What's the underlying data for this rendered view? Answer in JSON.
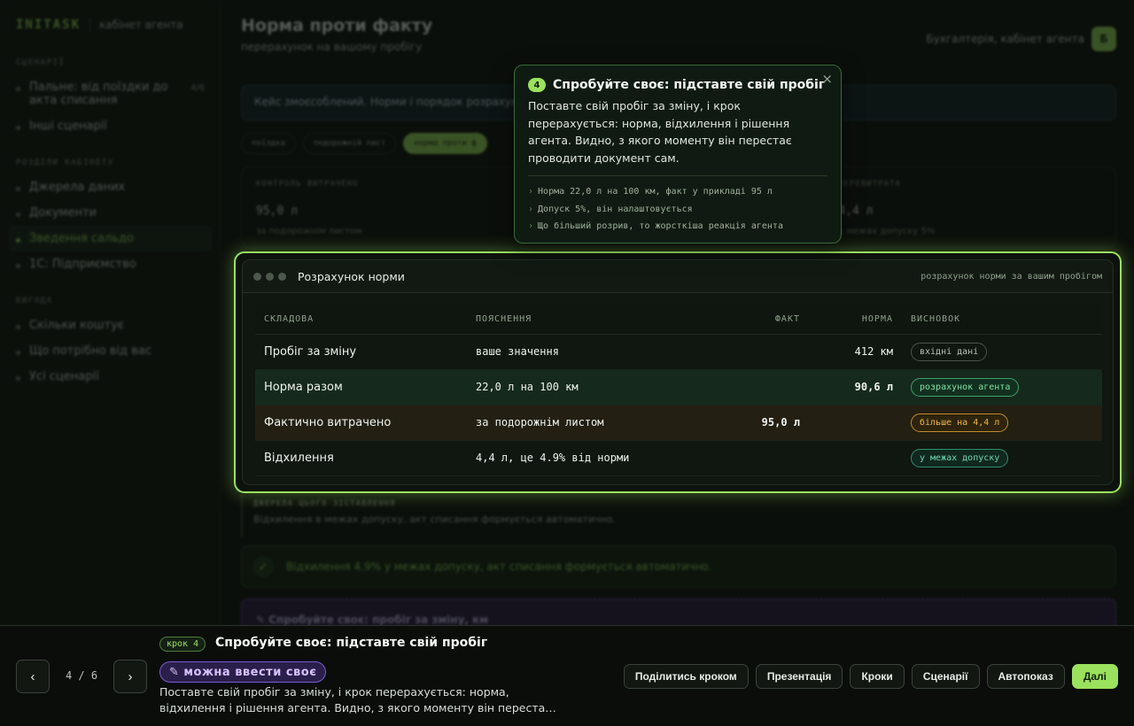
{
  "sidebar": {
    "brand": "INITASK",
    "brand_sub": "кабінет агента",
    "sections": [
      {
        "title": "СЦЕНАРІЇ",
        "items": [
          {
            "label": "Пальне: від поїздки до акта списання",
            "count": "4/6"
          },
          {
            "label": "Інші сценарії"
          }
        ]
      },
      {
        "title": "РОЗДІЛИ КАБІНЕТУ",
        "items": [
          {
            "label": "Джерела даних"
          },
          {
            "label": "Документи"
          },
          {
            "label": "Зведення сальдо"
          },
          {
            "label": "1С: Підприємство"
          }
        ]
      },
      {
        "title": "ВИГОДА",
        "items": [
          {
            "label": "Скільки коштує"
          },
          {
            "label": "Що потрібно від вас"
          },
          {
            "label": "Усі сценарії"
          }
        ]
      }
    ]
  },
  "header": {
    "title": "Норма проти факту",
    "subtitle": "перерахунок на вашому пробігу",
    "account": "Бухгалтерія, кабінет агента",
    "avatar": "Б"
  },
  "info_bar": "Кейс змоєсоблений. Норми і порядок розрахунку",
  "chips": [
    "поїздка",
    "подорожній лист",
    "норма проти ф"
  ],
  "metrics": [
    {
      "key": "КОНТРОЛЬ ВИТРАЧЕНО",
      "value": "95,0 л",
      "sub": "за подорожнім листом"
    },
    {
      "key": "",
      "value": "",
      "sub": ""
    },
    {
      "key": "ПЕРЕВИТРАТА",
      "value": "4,4 л",
      "sub": "у межах допуску 5%"
    }
  ],
  "card": {
    "title": "Розрахунок норми",
    "hint": "розрахунок норми за вашим пробігом",
    "columns": [
      "СКЛАДОВА",
      "ПОЯСНЕННЯ",
      "ФАКТ",
      "НОРМА",
      "ВИСНОВОК"
    ],
    "rows": [
      {
        "item": "Пробіг за зміну",
        "note": "ваше значення",
        "fact": "",
        "norm": "412 км",
        "verdict": "вхідні дані"
      },
      {
        "item": "Норма разом",
        "note": "22,0 л на 100 км",
        "fact": "",
        "norm": "90,6 л",
        "verdict": "розрахунок агента"
      },
      {
        "item": "Фактично витрачено",
        "note": "за подорожнім листом",
        "fact": "95,0 л",
        "norm": "",
        "verdict": "більше на 4,4 л"
      },
      {
        "item": "Відхилення",
        "note": "4,4 л, це 4.9% від норми",
        "fact": "",
        "norm": "",
        "verdict": "у межах допуску"
      }
    ]
  },
  "sources": {
    "title": "ДЖЕРЕЛА ЦЬОГО ЗІСТАВЛЕННЯ",
    "text": "Відхилення в межах допуску, акт списання формується автоматично."
  },
  "result": {
    "check": "✓",
    "text": "Відхилення 4.9% у межах допуску, акт списання формується автоматично."
  },
  "try_box": "✎ Спробуйте своє: пробіг за зміну, км",
  "popover": {
    "num": "4",
    "title": "Спробуйте своє: підставте свій пробіг",
    "close": "×",
    "body": "Поставте свій пробіг за зміну, і крок перерахується: норма, відхилення і рішення агента. Видно, з якого моменту він перестає проводити документ сам.",
    "bullets": [
      "Норма 22,0 л на 100 км, факт у прикладі 95 л",
      "Допуск 5%, він налаштовується",
      "Що більший розрив, то жорсткіша реакція агента"
    ]
  },
  "tour": {
    "prev": "‹",
    "next": "›",
    "counter": "4 / 6",
    "step_tag": "крок 4",
    "step_title": "Спробуйте своє: підставте свій пробіг",
    "edit_label": "✎ можна ввести своє",
    "desc": "Поставте свій пробіг за зміну, і крок перерахується: норма, відхилення і рішення агента. Видно, з якого моменту він переста…",
    "actions": [
      "Поділитись кроком",
      "Презентація",
      "Кроки",
      "Сценарії",
      "Автопоказ",
      "Далі"
    ]
  },
  "colors": {
    "accent": "#9be15d",
    "purple": "#7a5ad0",
    "amber": "#f0b74a"
  }
}
